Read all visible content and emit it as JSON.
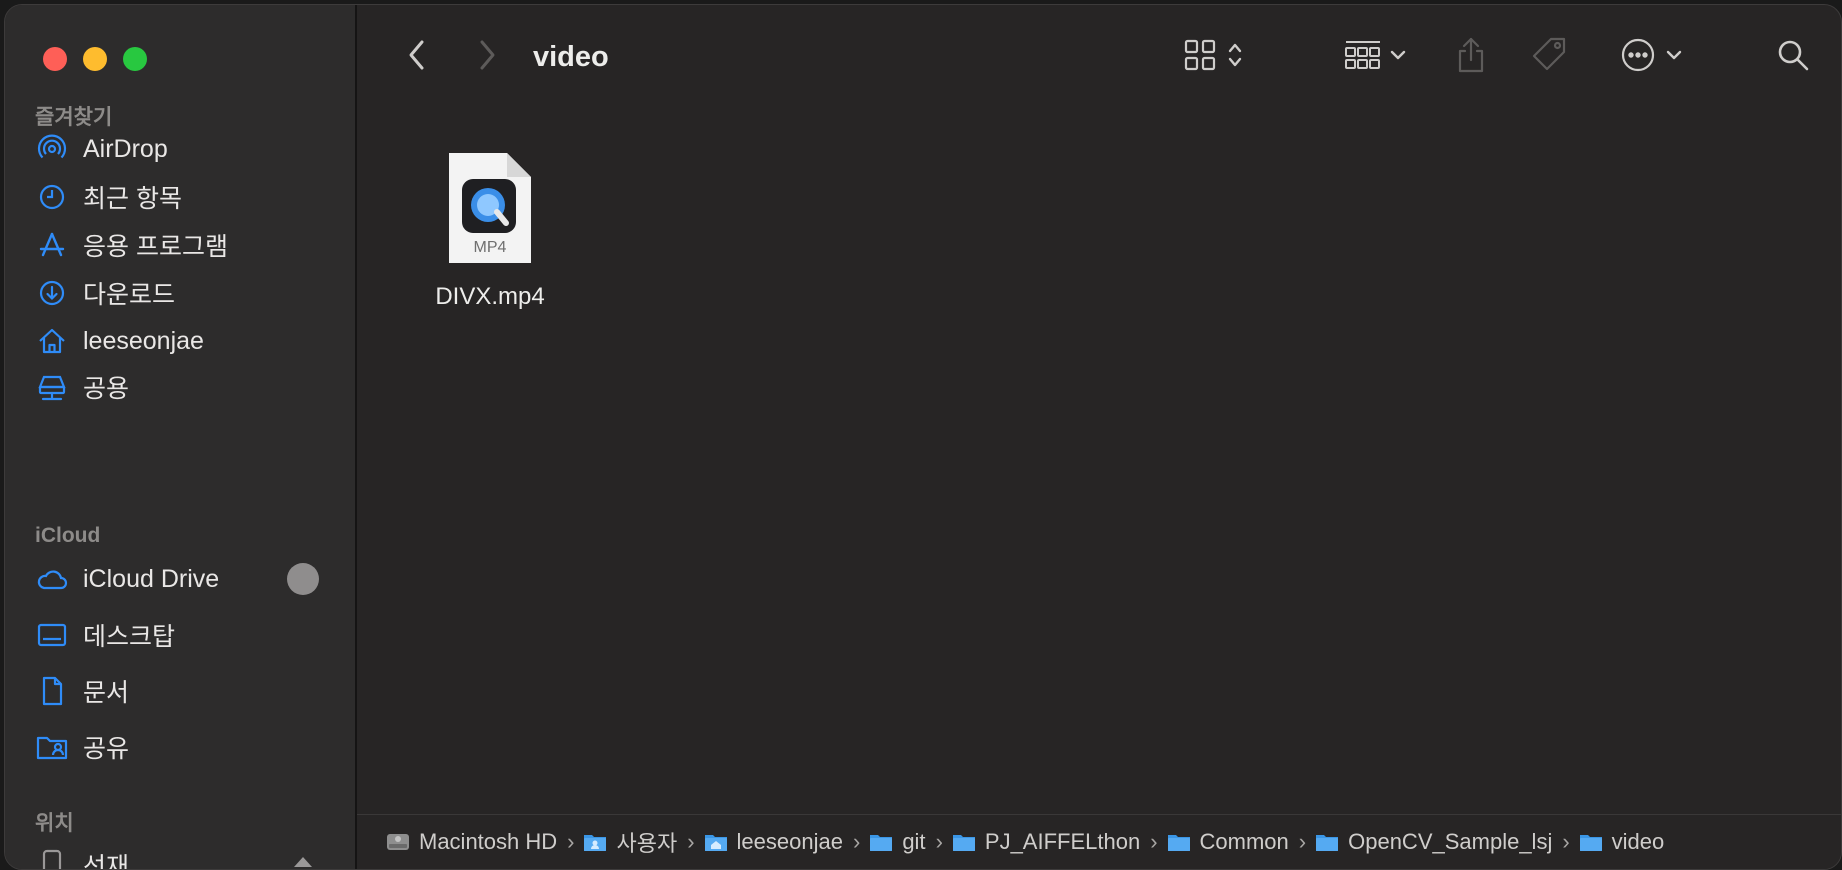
{
  "window": {
    "title": "video"
  },
  "sidebar": {
    "favorites_label": "즐겨찾기",
    "favorites": [
      {
        "label": "AirDrop",
        "icon": "airdrop-icon"
      },
      {
        "label": "최근 항목",
        "icon": "clock-icon"
      },
      {
        "label": "응용 프로그램",
        "icon": "applications-icon"
      },
      {
        "label": "다운로드",
        "icon": "download-icon"
      },
      {
        "label": "leeseonjae",
        "icon": "home-icon"
      },
      {
        "label": "공용",
        "icon": "shared-drive-icon"
      }
    ],
    "icloud_label": "iCloud",
    "icloud": [
      {
        "label": "iCloud Drive",
        "icon": "cloud-icon"
      },
      {
        "label": "데스크탑",
        "icon": "desktop-icon"
      },
      {
        "label": "문서",
        "icon": "document-icon"
      },
      {
        "label": "공유",
        "icon": "shared-folder-icon"
      }
    ],
    "locations_label": "위치",
    "locations": [
      {
        "label": "선재",
        "icon": "phone-icon"
      }
    ]
  },
  "files": [
    {
      "name": "DIVX.mp4",
      "badge": "MP4",
      "icon": "quicktime-icon"
    }
  ],
  "pathbar": [
    {
      "label": "Macintosh HD",
      "icon": "hard-drive-icon"
    },
    {
      "label": "사용자",
      "icon": "folder-icon"
    },
    {
      "label": "leeseonjae",
      "icon": "folder-icon"
    },
    {
      "label": "git",
      "icon": "folder-icon"
    },
    {
      "label": "PJ_AIFFELthon",
      "icon": "folder-icon"
    },
    {
      "label": "Common",
      "icon": "folder-icon"
    },
    {
      "label": "OpenCV_Sample_lsj",
      "icon": "folder-icon"
    },
    {
      "label": "video",
      "icon": "folder-icon"
    }
  ],
  "colors": {
    "accent": "#2f8cf8",
    "background": "#272525",
    "sidebar": "#2d2c2c"
  }
}
